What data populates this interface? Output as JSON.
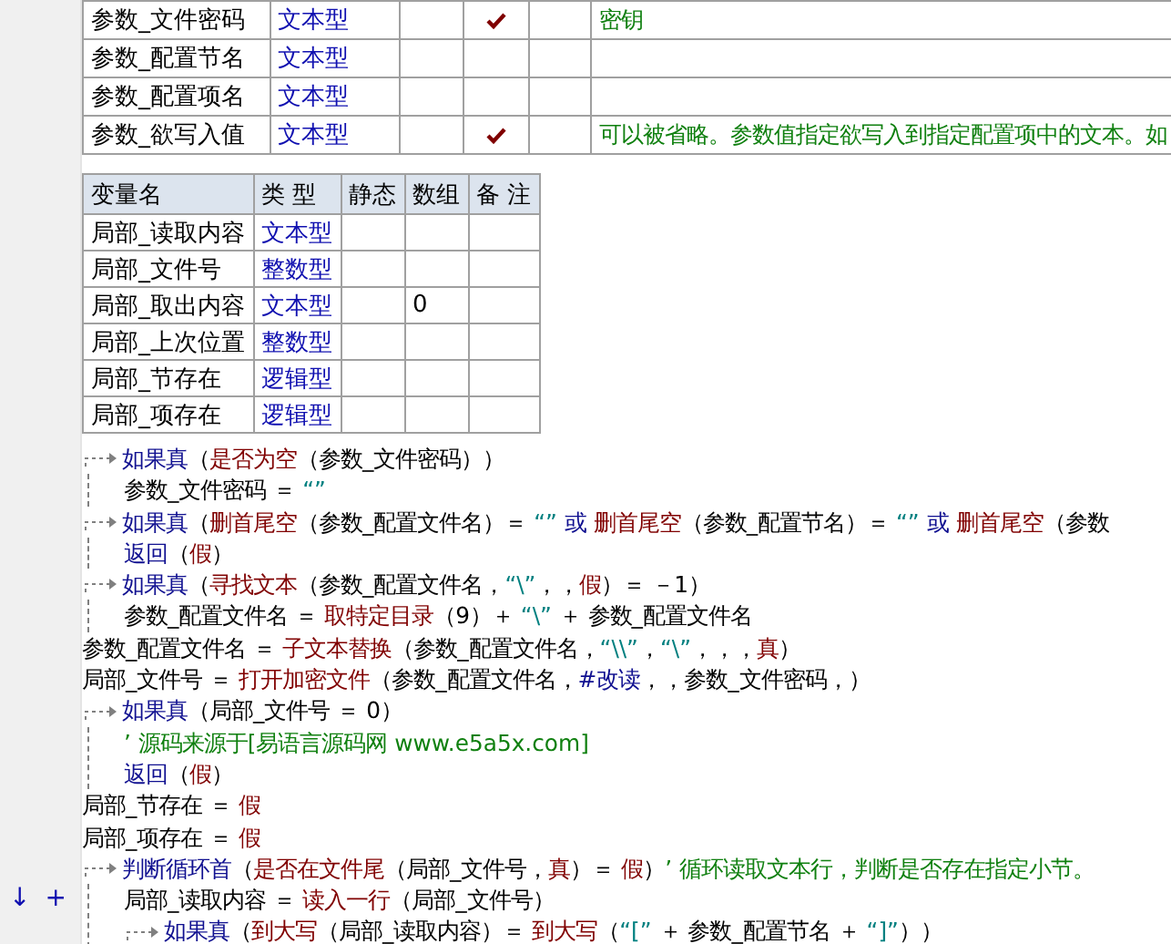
{
  "params": [
    {
      "name": "参数_文件密码",
      "type": "文本型",
      "checked": true,
      "remark": "密钥"
    },
    {
      "name": "参数_配置节名",
      "type": "文本型",
      "checked": false
    },
    {
      "name": "参数_配置项名",
      "type": "文本型",
      "checked": false
    },
    {
      "name": "参数_欲写入值",
      "type": "文本型",
      "checked": true,
      "remark": "可以被省略。参数值指定欲写入到指定配置项中的文本。如"
    }
  ],
  "locals": {
    "columns": [
      "变量名",
      "类 型",
      "静态",
      "数组",
      "备 注"
    ],
    "rows": [
      {
        "name": "局部_读取内容",
        "type": "文本型",
        "array": ""
      },
      {
        "name": "局部_文件号",
        "type": "整数型",
        "array": ""
      },
      {
        "name": "局部_取出内容",
        "type": "文本型",
        "array": "0"
      },
      {
        "name": "局部_上次位置",
        "type": "整数型",
        "array": ""
      },
      {
        "name": "局部_节存在",
        "type": "逻辑型",
        "array": ""
      },
      {
        "name": "局部_项存在",
        "type": "逻辑型",
        "array": ""
      }
    ]
  },
  "code": [
    {
      "segments": [
        {
          "kind": "kw",
          "t": "如果真"
        },
        {
          "kind": "id",
          "t": "（"
        },
        {
          "kind": "fn",
          "t": "是否为空"
        },
        {
          "kind": "id",
          "t": "（参数_文件密码））"
        }
      ],
      "children": [
        {
          "segments": [
            {
              "kind": "id",
              "t": "参数_文件密码 ＝ "
            },
            {
              "kind": "str",
              "t": "“”"
            }
          ]
        }
      ]
    },
    {
      "segments": [
        {
          "kind": "kw",
          "t": "如果真"
        },
        {
          "kind": "id",
          "t": "（"
        },
        {
          "kind": "fn",
          "t": "删首尾空"
        },
        {
          "kind": "id",
          "t": "（参数_配置文件名）＝ "
        },
        {
          "kind": "str",
          "t": "“”"
        },
        {
          "kind": "kw",
          "t": " 或 "
        },
        {
          "kind": "fn",
          "t": "删首尾空"
        },
        {
          "kind": "id",
          "t": "（参数_配置节名）＝ "
        },
        {
          "kind": "str",
          "t": "“”"
        },
        {
          "kind": "kw",
          "t": " 或 "
        },
        {
          "kind": "fn",
          "t": "删首尾空"
        },
        {
          "kind": "id",
          "t": "（参数"
        }
      ],
      "children": [
        {
          "segments": [
            {
              "kind": "kw",
              "t": "返回"
            },
            {
              "kind": "id",
              "t": "（"
            },
            {
              "kind": "const",
              "t": "假"
            },
            {
              "kind": "id",
              "t": "）"
            }
          ]
        }
      ]
    },
    {
      "segments": [
        {
          "kind": "kw",
          "t": "如果真"
        },
        {
          "kind": "id",
          "t": "（"
        },
        {
          "kind": "fn",
          "t": "寻找文本"
        },
        {
          "kind": "id",
          "t": "（参数_配置文件名，"
        },
        {
          "kind": "str",
          "t": "“\\”"
        },
        {
          "kind": "id",
          "t": "，，"
        },
        {
          "kind": "const",
          "t": "假"
        },
        {
          "kind": "id",
          "t": "）＝ －1）"
        }
      ],
      "children": [
        {
          "segments": [
            {
              "kind": "id",
              "t": "参数_配置文件名 ＝ "
            },
            {
              "kind": "fn",
              "t": "取特定目录"
            },
            {
              "kind": "id",
              "t": "（9）＋ "
            },
            {
              "kind": "str",
              "t": "“\\”"
            },
            {
              "kind": "id",
              "t": " ＋ 参数_配置文件名"
            }
          ]
        }
      ]
    },
    {
      "segments": [
        {
          "kind": "id",
          "t": "参数_配置文件名 ＝ "
        },
        {
          "kind": "fn",
          "t": "子文本替换"
        },
        {
          "kind": "id",
          "t": "（参数_配置文件名，"
        },
        {
          "kind": "str",
          "t": "“\\\\”"
        },
        {
          "kind": "id",
          "t": "，"
        },
        {
          "kind": "str",
          "t": "“\\”"
        },
        {
          "kind": "id",
          "t": "，，，"
        },
        {
          "kind": "const",
          "t": "真"
        },
        {
          "kind": "id",
          "t": "）"
        }
      ]
    },
    {
      "segments": [
        {
          "kind": "id",
          "t": "局部_文件号 ＝ "
        },
        {
          "kind": "fn",
          "t": "打开加密文件"
        },
        {
          "kind": "id",
          "t": "（参数_配置文件名，"
        },
        {
          "kind": "kw",
          "t": "#改读"
        },
        {
          "kind": "id",
          "t": "，，参数_文件密码，）"
        }
      ]
    },
    {
      "segments": [
        {
          "kind": "kw",
          "t": "如果真"
        },
        {
          "kind": "id",
          "t": "（局部_文件号 ＝ 0）"
        }
      ],
      "children": [
        {
          "segments": [
            {
              "kind": "cm",
              "t": "’ 源码来源于[易语言源码网 www.e5a5x.com]"
            }
          ]
        },
        {
          "segments": [
            {
              "kind": "kw",
              "t": "返回"
            },
            {
              "kind": "id",
              "t": "（"
            },
            {
              "kind": "const",
              "t": "假"
            },
            {
              "kind": "id",
              "t": "）"
            }
          ]
        }
      ]
    },
    {
      "segments": [
        {
          "kind": "id",
          "t": "局部_节存在 ＝ "
        },
        {
          "kind": "const",
          "t": "假"
        }
      ]
    },
    {
      "segments": [
        {
          "kind": "id",
          "t": "局部_项存在 ＝ "
        },
        {
          "kind": "const",
          "t": "假"
        }
      ]
    },
    {
      "segments": [
        {
          "kind": "kw",
          "t": "判断循环首"
        },
        {
          "kind": "id",
          "t": "（"
        },
        {
          "kind": "fn",
          "t": "是否在文件尾"
        },
        {
          "kind": "id",
          "t": "（局部_文件号，"
        },
        {
          "kind": "const",
          "t": "真"
        },
        {
          "kind": "id",
          "t": "）＝ "
        },
        {
          "kind": "const",
          "t": "假"
        },
        {
          "kind": "id",
          "t": "）"
        },
        {
          "kind": "cm",
          "t": "’ 循环读取文本行，判断是否存在指定小节。"
        }
      ],
      "children": [
        {
          "gutter": [
            "↓",
            "+"
          ],
          "segments": [
            {
              "kind": "id",
              "t": "局部_读取内容 ＝ "
            },
            {
              "kind": "fn",
              "t": "读入一行"
            },
            {
              "kind": "id",
              "t": "（局部_文件号）"
            }
          ]
        },
        {
          "segments": [
            {
              "kind": "kw",
              "t": "如果真"
            },
            {
              "kind": "id",
              "t": "（"
            },
            {
              "kind": "fn",
              "t": "到大写"
            },
            {
              "kind": "id",
              "t": "（局部_读取内容）＝ "
            },
            {
              "kind": "fn",
              "t": "到大写"
            },
            {
              "kind": "id",
              "t": "（"
            },
            {
              "kind": "str",
              "t": "“[”"
            },
            {
              "kind": "id",
              "t": " ＋ 参数_配置节名 ＋ "
            },
            {
              "kind": "str",
              "t": "“]”"
            },
            {
              "kind": "id",
              "t": "））"
            }
          ],
          "kind": "block"
        }
      ]
    }
  ]
}
